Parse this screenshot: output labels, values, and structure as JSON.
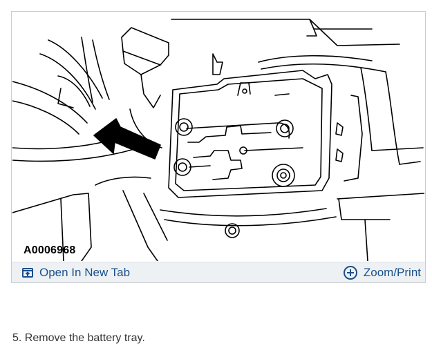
{
  "figure": {
    "image_id": "A0006968",
    "illustration": "line drawing of battery tray with arrow"
  },
  "actions": {
    "open_new_tab": "Open In New Tab",
    "zoom_print": "Zoom/Print"
  },
  "icons": {
    "open_new_tab": "open-in-new-tab-icon",
    "zoom_print": "plus-circle-icon"
  },
  "colors": {
    "accent": "#1a4f8b",
    "bar_bg": "#eef1f4",
    "border": "#c8cdd2"
  },
  "instruction": {
    "text": "5. Remove the battery tray."
  }
}
